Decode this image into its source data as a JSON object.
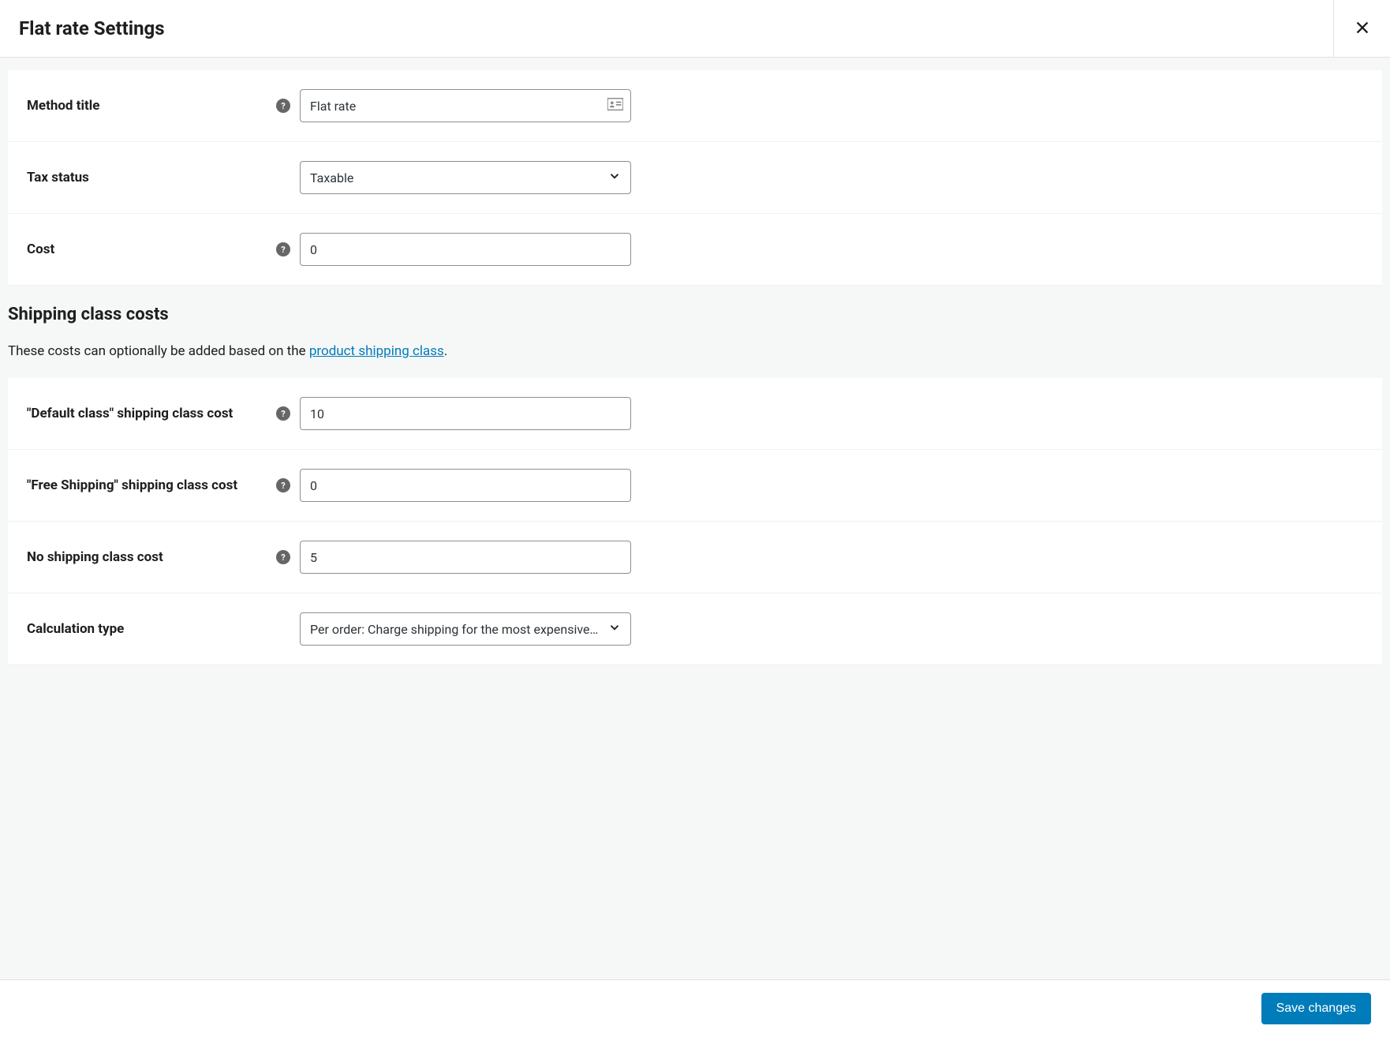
{
  "header": {
    "title": "Flat rate Settings"
  },
  "fields": {
    "method_title": {
      "label": "Method title",
      "value": "Flat rate"
    },
    "tax_status": {
      "label": "Tax status",
      "value": "Taxable"
    },
    "cost": {
      "label": "Cost",
      "value": "0"
    },
    "default_class": {
      "label": "\"Default class\" shipping class cost",
      "value": "10"
    },
    "free_shipping_class": {
      "label": "\"Free Shipping\" shipping class cost",
      "value": "0"
    },
    "no_class": {
      "label": "No shipping class cost",
      "value": "5"
    },
    "calc_type": {
      "label": "Calculation type",
      "value": "Per order: Charge shipping for the most expensive shipping class"
    }
  },
  "sections": {
    "shipping_class_costs": {
      "heading": "Shipping class costs",
      "desc_prefix": "These costs can optionally be added based on the ",
      "link_text": "product shipping class",
      "desc_suffix": "."
    }
  },
  "footer": {
    "save_label": "Save changes"
  }
}
